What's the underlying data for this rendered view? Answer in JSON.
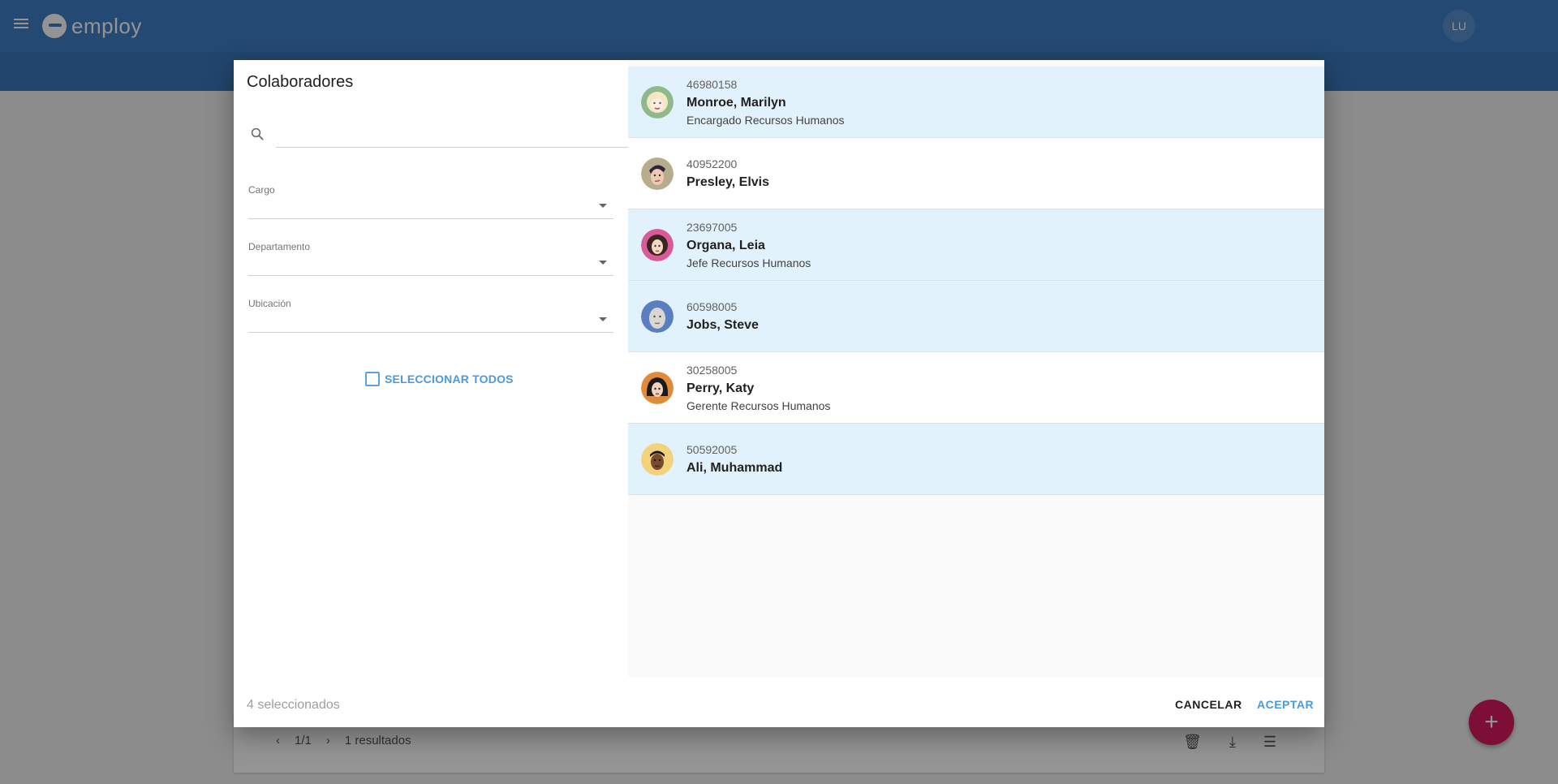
{
  "app": {
    "brand": "employ",
    "user_initials": "LU"
  },
  "background": {
    "pager_page": "1/1",
    "pager_results": "1 resultados"
  },
  "dialog": {
    "title": "Colaboradores",
    "search": {
      "placeholder": "",
      "value": ""
    },
    "filters": [
      {
        "label": "Cargo",
        "value": ""
      },
      {
        "label": "Departamento",
        "value": ""
      },
      {
        "label": "Ubicación",
        "value": ""
      }
    ],
    "select_all_label": "SELECCIONAR TODOS",
    "employees": [
      {
        "id": "46980158",
        "name": "Monroe, Marilyn",
        "role": "Encargado Recursos Humanos",
        "selected": true,
        "avatar_color": "#8fb98a"
      },
      {
        "id": "40952200",
        "name": "Presley, Elvis",
        "role": "",
        "selected": false,
        "avatar_color": "#b5ad8c"
      },
      {
        "id": "23697005",
        "name": "Organa, Leia",
        "role": "Jefe Recursos Humanos",
        "selected": true,
        "avatar_color": "#d85a98"
      },
      {
        "id": "60598005",
        "name": "Jobs, Steve",
        "role": "",
        "selected": true,
        "avatar_color": "#5a7fc0"
      },
      {
        "id": "30258005",
        "name": "Perry, Katy",
        "role": "Gerente Recursos Humanos",
        "selected": false,
        "avatar_color": "#e08a3c"
      },
      {
        "id": "50592005",
        "name": "Ali, Muhammad",
        "role": "",
        "selected": true,
        "avatar_color": "#f2d27a"
      }
    ],
    "footer": {
      "selected_count": "4 seleccionados",
      "cancel_label": "CANCELAR",
      "accept_label": "ACEPTAR"
    }
  },
  "colors": {
    "header_blue": "#3f7fc4",
    "accent_blue": "#4a9ae0",
    "selected_row": "#e2f2fc",
    "fab_pink": "#d81b60"
  }
}
